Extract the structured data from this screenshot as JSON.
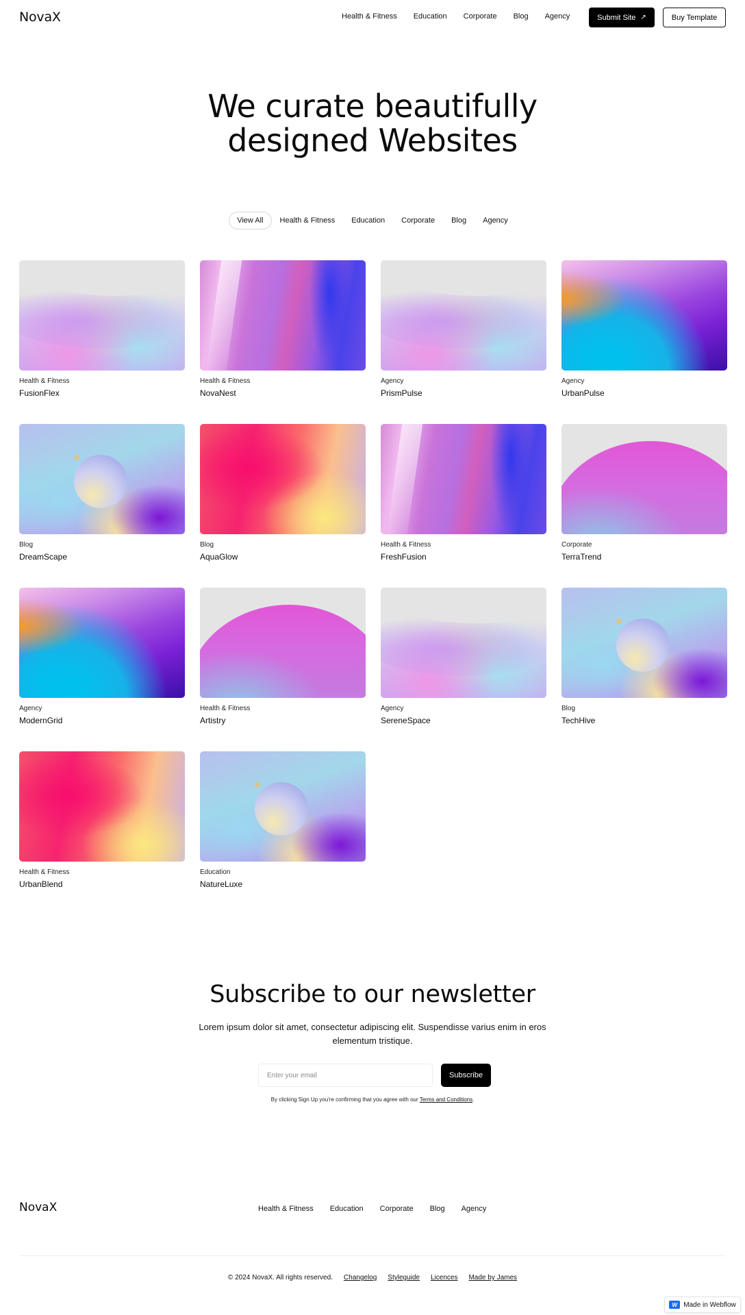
{
  "header": {
    "logo": "NovaX",
    "nav": [
      "Health & Fitness",
      "Education",
      "Corporate",
      "Blog",
      "Agency"
    ],
    "submit_label": "Submit Site",
    "buy_label": "Buy Template"
  },
  "hero": {
    "title_line1": "We curate beautifully",
    "title_line2": "designed Websites"
  },
  "filters": [
    "View All",
    "Health & Fitness",
    "Education",
    "Corporate",
    "Blog",
    "Agency"
  ],
  "cards": [
    {
      "category": "Health & Fitness",
      "name": "FusionFlex",
      "art": "waves"
    },
    {
      "category": "Health & Fitness",
      "name": "NovaNest",
      "art": "prism"
    },
    {
      "category": "Agency",
      "name": "PrismPulse",
      "art": "waves"
    },
    {
      "category": "Agency",
      "name": "UrbanPulse",
      "art": "purple"
    },
    {
      "category": "Blog",
      "name": "DreamScape",
      "art": "sphere"
    },
    {
      "category": "Blog",
      "name": "AquaGlow",
      "art": "sunset"
    },
    {
      "category": "Health & Fitness",
      "name": "FreshFusion",
      "art": "prism"
    },
    {
      "category": "Corporate",
      "name": "TerraTrend",
      "art": "hill"
    },
    {
      "category": "Agency",
      "name": "ModernGrid",
      "art": "purple"
    },
    {
      "category": "Health & Fitness",
      "name": "Artistry",
      "art": "hill"
    },
    {
      "category": "Agency",
      "name": "SereneSpace",
      "art": "waves"
    },
    {
      "category": "Blog",
      "name": "TechHive",
      "art": "sphere"
    },
    {
      "category": "Health & Fitness",
      "name": "UrbanBlend",
      "art": "sunset"
    },
    {
      "category": "Education",
      "name": "NatureLuxe",
      "art": "sphere"
    }
  ],
  "newsletter": {
    "title": "Subscribe to our newsletter",
    "text": "Lorem ipsum dolor sit amet, consectetur adipiscing elit. Suspendisse varius enim in eros elementum tristique.",
    "email_placeholder": "Enter your email",
    "subscribe_label": "Subscribe",
    "terms_prefix": "By clicking Sign Up you're confirming that you agree with our ",
    "terms_link": "Terms and Conditions",
    "terms_suffix": "."
  },
  "footer": {
    "logo": "NovaX",
    "nav": [
      "Health & Fitness",
      "Education",
      "Corporate",
      "Blog",
      "Agency"
    ],
    "copyright": "© 2024 NovaX. All rights reserved.",
    "links": [
      "Changelog",
      "Styleguide",
      "Licences",
      "Made by James"
    ]
  },
  "badge": {
    "label": "Made in Webflow",
    "icon": "webflow-icon"
  }
}
